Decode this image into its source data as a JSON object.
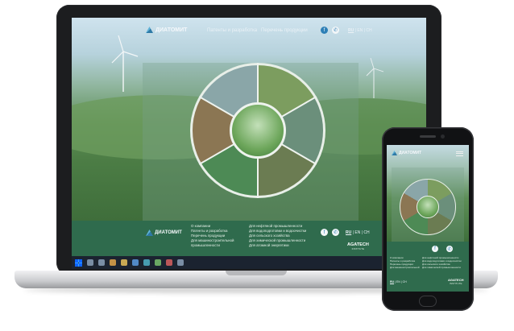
{
  "site": {
    "logo_text": "ДИАТОМИТ",
    "nav": [
      "Патенты и разработка",
      "Перечень продукции"
    ],
    "social": {
      "fb": "f",
      "phone": "✆"
    },
    "lang": {
      "active": "RU",
      "others": [
        "EN",
        "CH"
      ]
    }
  },
  "footer": {
    "col1": [
      "О компании",
      "Патенты и разработка",
      "Перечень продукции",
      "Для машиностроительной",
      "промышленности"
    ],
    "col2": [
      "Для нефтяной промышленности",
      "Для водоподготовки и водоочистки",
      "Для сельского хозяйства",
      "Для химической промышленности",
      "Для атомной энергетики"
    ],
    "brand": "AGATECH",
    "brand_sub": "INSTITUTE"
  },
  "phone": {
    "logo_text": "ДИАТОМИТ",
    "lang": {
      "active": "RU",
      "others": [
        "EN",
        "CH"
      ]
    }
  },
  "colors": {
    "footer": "#2f6b4d",
    "accent": "#2d7fb6",
    "taskbar": "#1b2330"
  },
  "icons": [
    "windows-start-icon",
    "search-icon",
    "task-view-icon",
    "browser-icon",
    "folder-icon",
    "mail-icon",
    "store-icon",
    "chat-icon",
    "media-icon",
    "settings-icon"
  ]
}
